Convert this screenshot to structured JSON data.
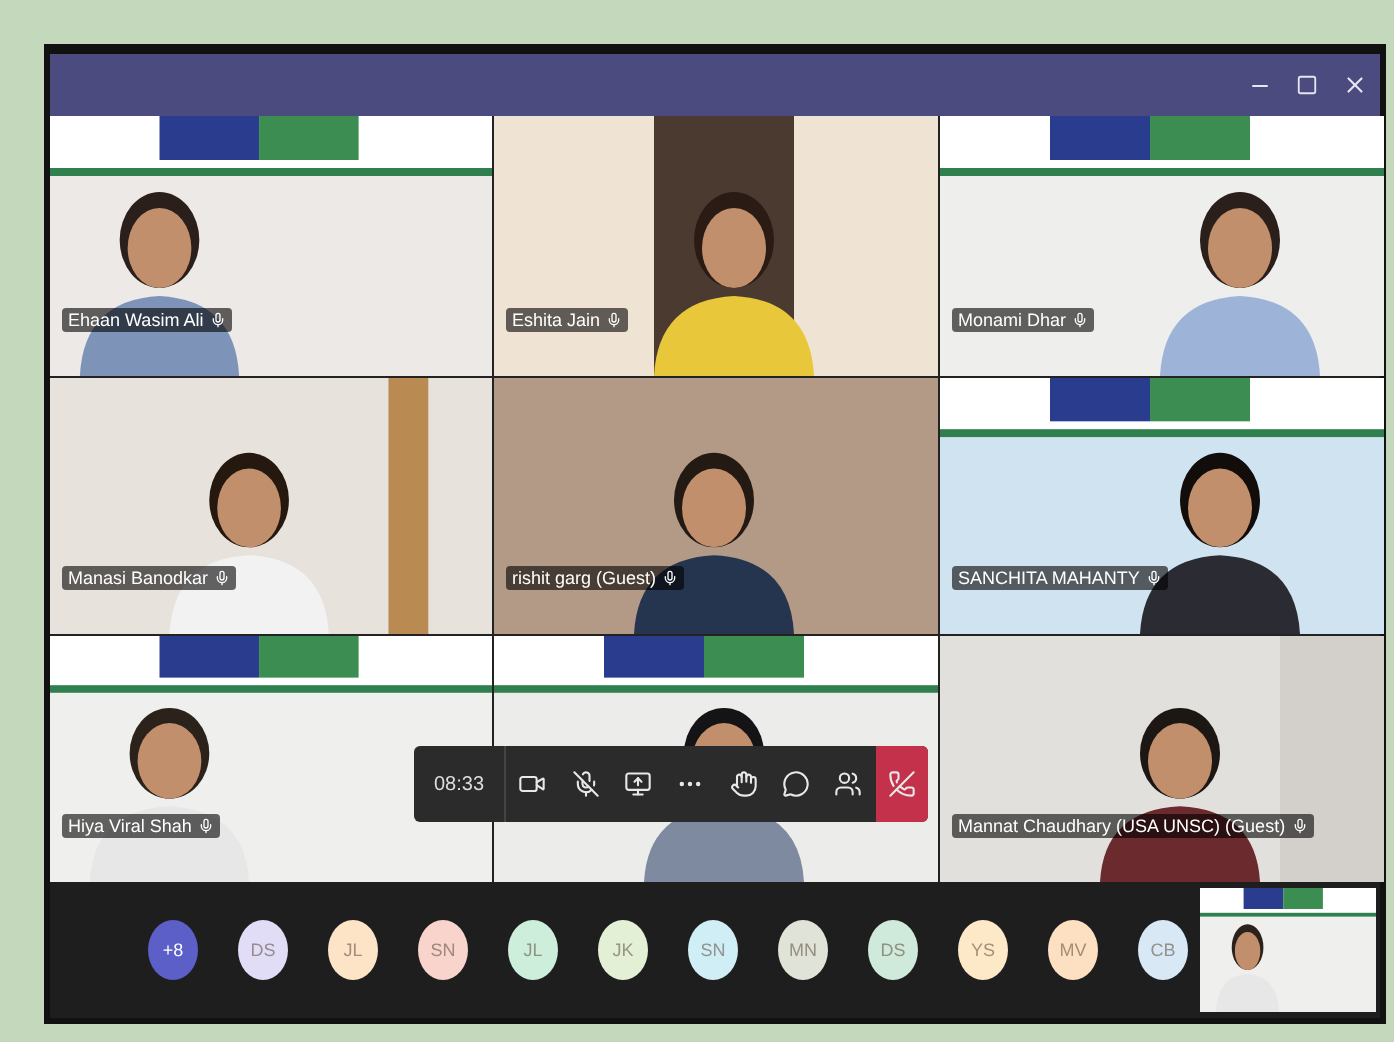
{
  "tiles": [
    {
      "kind": "picture",
      "name": "Ehaan Wasim Ali"
    },
    {
      "kind": "picture",
      "name": "Eshita Jain"
    },
    {
      "kind": "picture",
      "name": "Monami Dhar"
    },
    {
      "kind": "picture",
      "name": "Manasi Banodkar"
    },
    {
      "kind": "picture",
      "name": "rishit garg (Guest)"
    },
    {
      "kind": "picture",
      "name": "SANCHITA MAHANTY"
    },
    {
      "kind": "picture",
      "name": "Hiya Viral Shah"
    },
    {
      "kind": "picture"
    },
    {
      "kind": "picture",
      "name": "Mannat Chaudhary (USA UNSC) (Guest)"
    }
  ],
  "call_controls": {
    "timer": "08:33",
    "buttons": [
      {
        "kind": "camera"
      },
      {
        "kind": "mic-off"
      },
      {
        "kind": "share"
      },
      {
        "kind": "more"
      },
      {
        "kind": "raise-hand"
      },
      {
        "kind": "chat"
      },
      {
        "kind": "participants"
      },
      {
        "kind": "hang-up"
      }
    ]
  },
  "participants": [
    {
      "initials": "+8",
      "color": "#5b5fc7"
    },
    {
      "initials": "DS",
      "color": "#e2ddf6"
    },
    {
      "initials": "JL",
      "color": "#fde4c6"
    },
    {
      "initials": "SN",
      "color": "#f8d4cc"
    },
    {
      "initials": "JL",
      "color": "#cdeedb"
    },
    {
      "initials": "JK",
      "color": "#e4f0d6"
    },
    {
      "initials": "SN",
      "color": "#d0eef6"
    },
    {
      "initials": "MN",
      "color": "#e0e3d8"
    },
    {
      "initials": "DS",
      "color": "#cfe9da"
    },
    {
      "initials": "YS",
      "color": "#fde8c8"
    },
    {
      "initials": "MV",
      "color": "#fde0c2"
    },
    {
      "initials": "CB",
      "color": "#d8e8f5"
    }
  ]
}
